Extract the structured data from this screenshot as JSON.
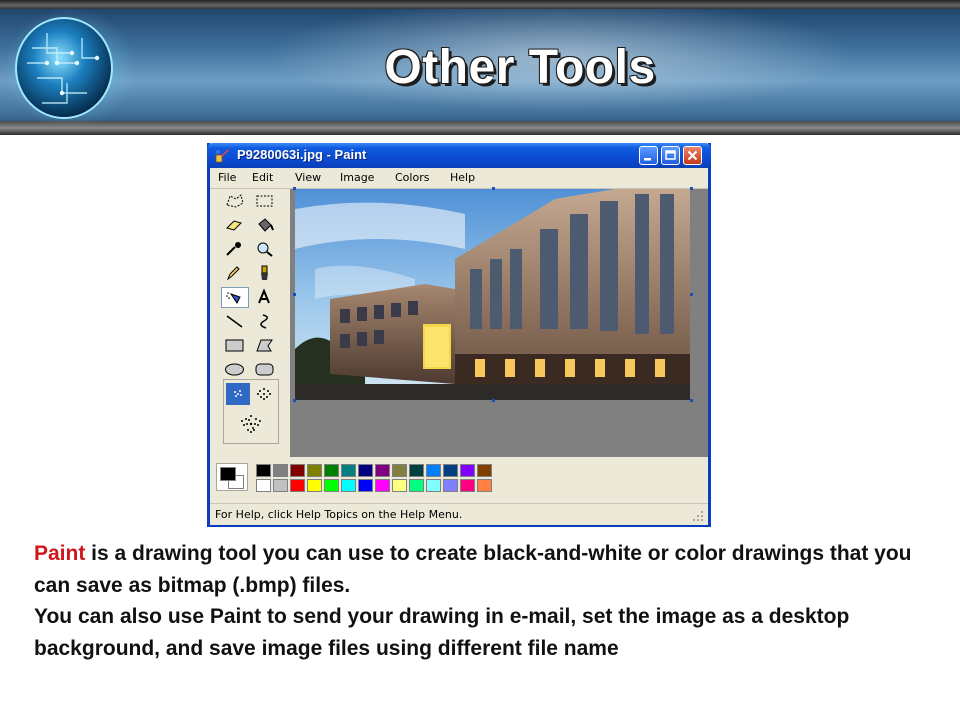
{
  "slide": {
    "title": "Other Tools"
  },
  "window": {
    "title": "P9280063i.jpg - Paint",
    "menu": [
      "File",
      "Edit",
      "View",
      "Image",
      "Colors",
      "Help"
    ],
    "status": "For Help, click Help Topics on the Help Menu.",
    "tools": [
      "free-form-select",
      "select",
      "eraser",
      "fill-with-color",
      "pick-color",
      "magnifier",
      "pencil",
      "brush",
      "airbrush",
      "text",
      "line",
      "curve",
      "rectangle",
      "polygon",
      "ellipse",
      "rounded-rectangle"
    ],
    "selected_tool": "airbrush",
    "palette_top": [
      "#000000",
      "#808080",
      "#800000",
      "#808000",
      "#008000",
      "#008080",
      "#000080",
      "#800080",
      "#808040",
      "#004040",
      "#0080ff",
      "#004080",
      "#8000ff",
      "#804000"
    ],
    "palette_bottom": [
      "#ffffff",
      "#c0c0c0",
      "#ff0000",
      "#ffff00",
      "#00ff00",
      "#00ffff",
      "#0000ff",
      "#ff00ff",
      "#ffff80",
      "#00ff80",
      "#80ffff",
      "#8080ff",
      "#ff0080",
      "#ff8040"
    ],
    "foreground_color": "#000000",
    "background_color": "#ffffff"
  },
  "body": {
    "p1_keyword": "Paint",
    "p1_rest": " is a drawing tool you can use to create black-and-white or color drawings that you can save as bitmap (.bmp) files.",
    "p2": "You can also use Paint to send your drawing in e-mail, set the image as a desktop background, and save image files using different file name"
  },
  "colors": {
    "accent_red": "#d1161b",
    "xp_blue": "#0a49d0"
  }
}
